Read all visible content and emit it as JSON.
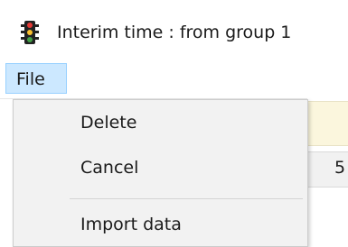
{
  "window": {
    "title": "Interim time : from group 1",
    "icon": "traffic-light-icon"
  },
  "menubar": {
    "items": [
      {
        "label": "File",
        "active": true
      }
    ]
  },
  "file_menu": {
    "items": [
      {
        "label": "Delete"
      },
      {
        "label": "Cancel"
      },
      {
        "label": "Import data"
      }
    ]
  },
  "background_table": {
    "visible_cell": "5"
  },
  "colors": {
    "menu_highlight": "#cce8ff",
    "menu_highlight_border": "#99d1ff",
    "dropdown_bg": "#f2f2f2",
    "header_bg": "#fbf6dd"
  }
}
